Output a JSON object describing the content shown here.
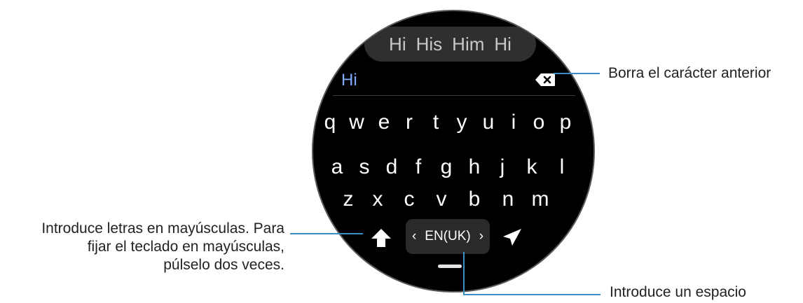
{
  "suggestions": [
    "Hi",
    "His",
    "Him",
    "Hi"
  ],
  "input_text": "Hi",
  "keyboard": {
    "row1": [
      "q",
      "w",
      "e",
      "r",
      "t",
      "y",
      "u",
      "i",
      "o",
      "p"
    ],
    "row2": [
      "a",
      "s",
      "d",
      "f",
      "g",
      "h",
      "j",
      "k",
      "l"
    ],
    "row3": [
      "z",
      "x",
      "c",
      "v",
      "b",
      "n",
      "m"
    ],
    "language": "EN(UK)",
    "lang_prev": "‹",
    "lang_next": "›"
  },
  "annotations": {
    "backspace": "Borra el carácter anterior",
    "shift_line1": "Introduce letras en mayúsculas. Para",
    "shift_line2": "fijar el teclado en mayúsculas,",
    "shift_line3": "púlselo dos veces.",
    "space": "Introduce un espacio"
  },
  "colors": {
    "accent_line": "#3a8fc4",
    "input_text": "#7fa8ff"
  }
}
